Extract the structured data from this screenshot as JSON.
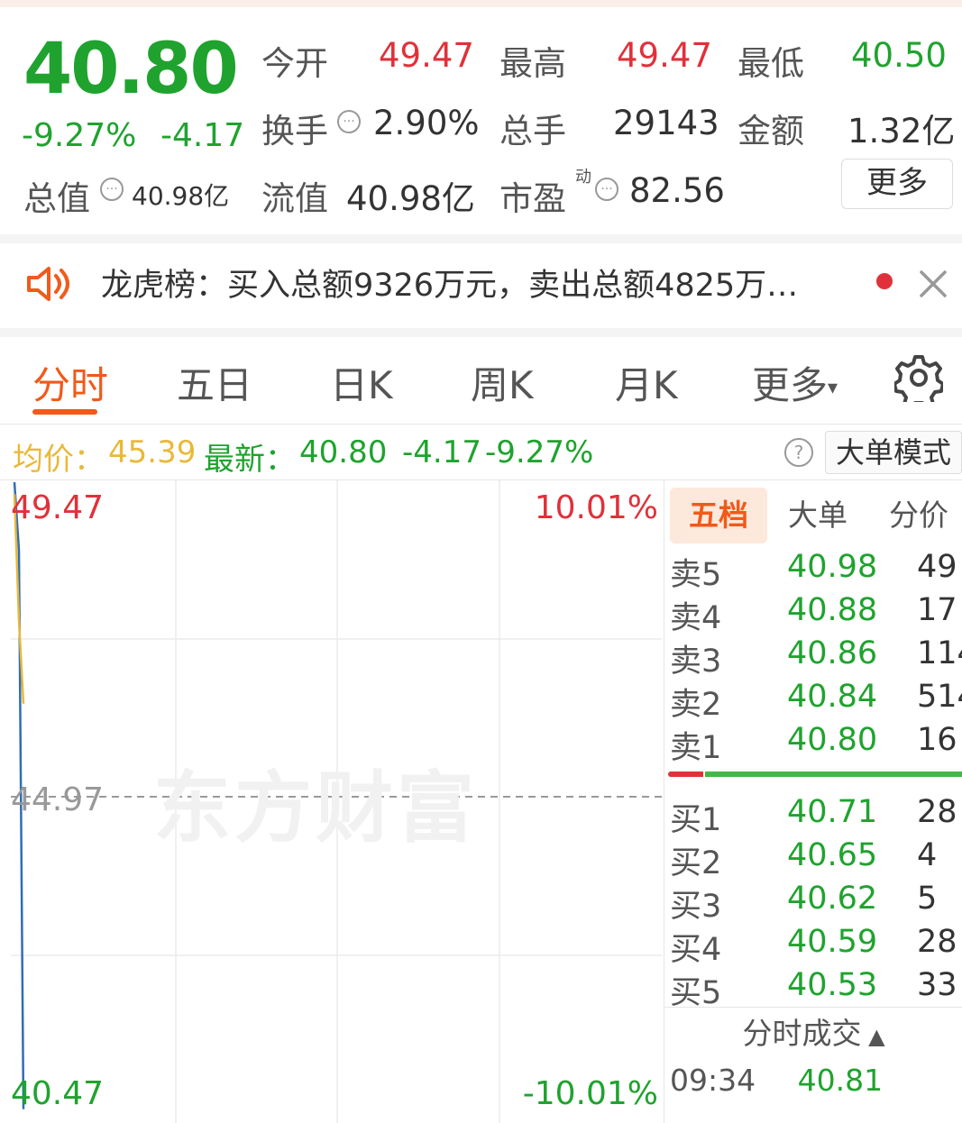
{
  "quote": {
    "price": "40.80",
    "change_pct": "-9.27%",
    "change_abs": "-4.17",
    "open_label": "今开",
    "open": "49.47",
    "high_label": "最高",
    "high": "49.47",
    "low_label": "最低",
    "low": "40.50",
    "turnover_label": "换手",
    "turnover": "2.90%",
    "volume_label": "总手",
    "volume": "29143",
    "amount_label": "金额",
    "amount": "1.32亿",
    "total_value_label": "总值",
    "total_value": "40.98亿",
    "float_value_label": "流值",
    "float_value": "40.98亿",
    "pe_label": "市盈",
    "pe_sup": "动",
    "pe": "82.56",
    "more_label": "更多"
  },
  "banner": {
    "text": "龙虎榜：买入总额9326万元，卖出总额4825万…"
  },
  "tabs": [
    "分时",
    "五日",
    "日K",
    "周K",
    "月K",
    "更多"
  ],
  "avg_bar": {
    "avg_label": "均价：",
    "avg_value": "45.39",
    "latest_label": "最新：",
    "latest_value": "40.80",
    "latest_change": "-4.17",
    "latest_pct": "-9.27%",
    "big_order_mode": "大单模式"
  },
  "chart": {
    "top_price": "49.47",
    "top_pct": "10.01%",
    "mid_price": "44.97",
    "bottom_price": "40.47",
    "bottom_pct": "-10.01%",
    "watermark": "东方财富"
  },
  "chart_data": {
    "type": "line",
    "ylim": [
      40.47,
      49.47
    ],
    "grid": true,
    "series": [
      {
        "name": "",
        "color": "#2f6db5",
        "x": [
          0,
          1,
          2
        ],
        "values": [
          49.47,
          48.5,
          40.5
        ]
      },
      {
        "name": "",
        "color": "#e8b93a",
        "x": [
          0,
          1,
          2
        ],
        "values": [
          49.3,
          47.5,
          46.3
        ]
      }
    ],
    "reference_line": 44.97
  },
  "order_book": {
    "tabs": [
      "五档",
      "大单",
      "分价"
    ],
    "asks": [
      {
        "label": "卖5",
        "price": "40.98",
        "vol": "49"
      },
      {
        "label": "卖4",
        "price": "40.88",
        "vol": "17"
      },
      {
        "label": "卖3",
        "price": "40.86",
        "vol": "114"
      },
      {
        "label": "卖2",
        "price": "40.84",
        "vol": "514"
      },
      {
        "label": "卖1",
        "price": "40.80",
        "vol": "16"
      }
    ],
    "bids": [
      {
        "label": "买1",
        "price": "40.71",
        "vol": "28"
      },
      {
        "label": "买2",
        "price": "40.65",
        "vol": "4"
      },
      {
        "label": "买3",
        "price": "40.62",
        "vol": "5"
      },
      {
        "label": "买4",
        "price": "40.59",
        "vol": "28"
      },
      {
        "label": "买5",
        "price": "40.53",
        "vol": "33"
      }
    ],
    "ratio_red": 0.12,
    "ticks_header": "分时成交",
    "ticks": [
      {
        "time": "09:34",
        "price": "40.81"
      }
    ]
  }
}
